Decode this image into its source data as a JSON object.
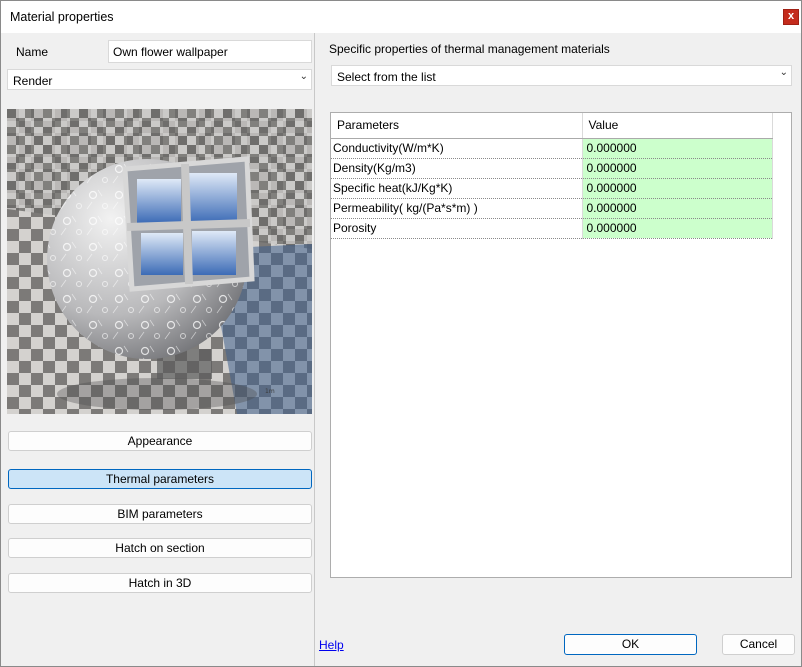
{
  "window": {
    "title": "Material properties",
    "close_glyph": "x"
  },
  "left": {
    "name_label": "Name",
    "name_value": "Own flower wallpaper",
    "mode_select": "Render",
    "preview_icon": "material-sphere-preview",
    "buttons": [
      "Appearance",
      "Thermal parameters",
      "BIM parameters",
      "Hatch on section",
      "Hatch in 3D"
    ],
    "active_button": "Thermal parameters"
  },
  "right": {
    "title": "Specific properties of thermal management materials",
    "list_select": "Select from the list",
    "table": {
      "headers": [
        "Parameters",
        "Value"
      ],
      "rows": [
        {
          "param": "Conductivity(W/m*K)",
          "value": "0.000000"
        },
        {
          "param": "Density(Kg/m3)",
          "value": "0.000000"
        },
        {
          "param": "Specific heat(kJ/Kg*K)",
          "value": "0.000000"
        },
        {
          "param": "Permeability( kg/(Pa*s*m) )",
          "value": "0.000000"
        },
        {
          "param": "Porosity",
          "value": "0.000000"
        }
      ]
    }
  },
  "footer": {
    "help": "Help",
    "ok": "OK",
    "cancel": "Cancel"
  },
  "colors": {
    "accent": "#0067c0",
    "active_bg": "#cce4f7",
    "value_bg": "#ccffcc",
    "close_bg": "#c42b1c"
  }
}
